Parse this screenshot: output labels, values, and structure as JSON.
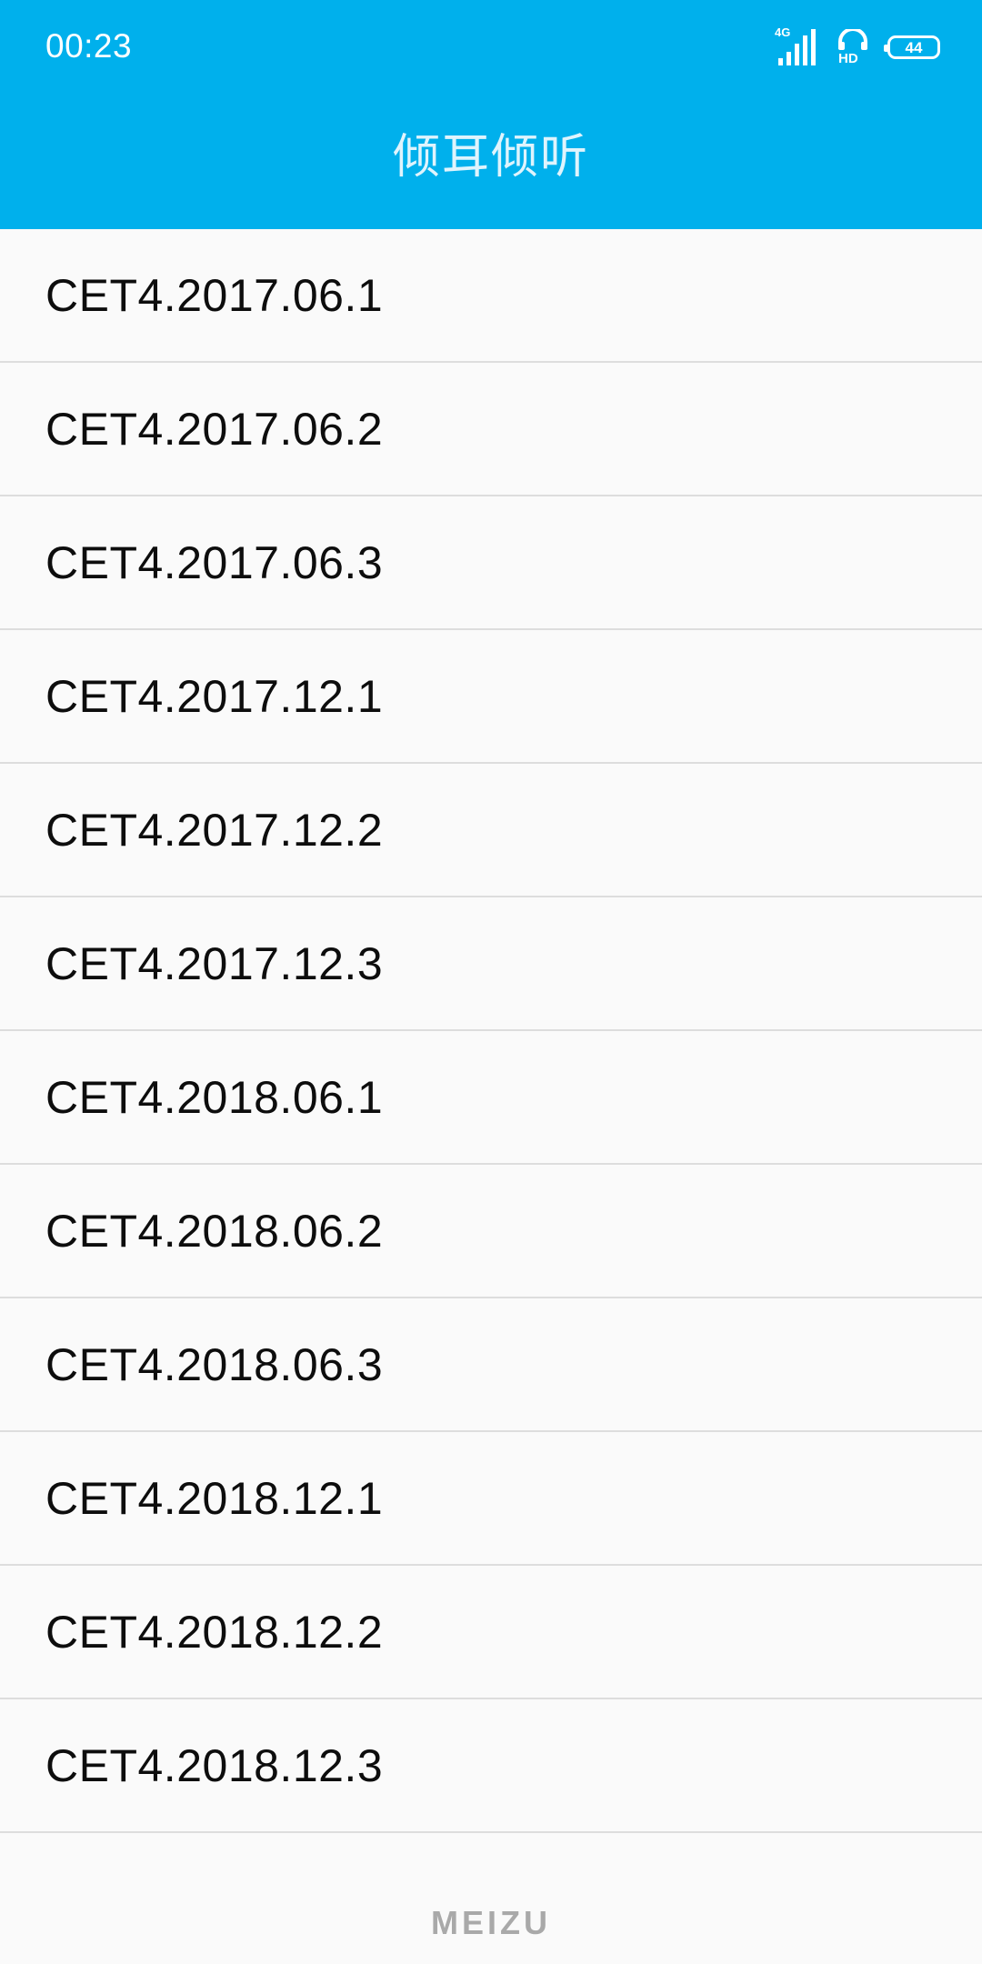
{
  "status_bar": {
    "time": "00:23",
    "network_type": "4G",
    "hd_label": "HD",
    "battery_level": "44",
    "icons": [
      "signal-icon",
      "headset-icon",
      "battery-icon"
    ]
  },
  "header": {
    "title": "倾耳倾听",
    "background_color": "#00b0ec"
  },
  "list": {
    "items": [
      {
        "label": "CET4.2017.06.1"
      },
      {
        "label": "CET4.2017.06.2"
      },
      {
        "label": "CET4.2017.06.3"
      },
      {
        "label": "CET4.2017.12.1"
      },
      {
        "label": "CET4.2017.12.2"
      },
      {
        "label": "CET4.2017.12.3"
      },
      {
        "label": "CET4.2018.06.1"
      },
      {
        "label": "CET4.2018.06.2"
      },
      {
        "label": "CET4.2018.06.3"
      },
      {
        "label": "CET4.2018.12.1"
      },
      {
        "label": "CET4.2018.12.2"
      },
      {
        "label": "CET4.2018.12.3"
      }
    ]
  },
  "footer": {
    "brand": "MEIZU"
  }
}
